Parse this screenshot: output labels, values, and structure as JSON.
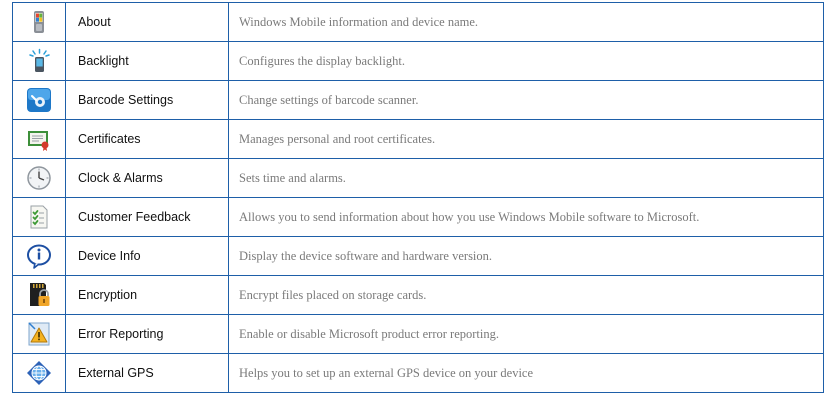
{
  "settings": [
    {
      "icon": "device-icon",
      "name": "About",
      "description": "Windows Mobile information and device name."
    },
    {
      "icon": "backlight-icon",
      "name": "Backlight",
      "description": "Configures the display backlight."
    },
    {
      "icon": "barcode-scanner-icon",
      "name": "Barcode Settings",
      "description": "Change settings of barcode scanner."
    },
    {
      "icon": "certificate-icon",
      "name": "Certificates",
      "description": "Manages personal and root certificates."
    },
    {
      "icon": "clock-icon",
      "name": "Clock & Alarms",
      "description": "Sets time and alarms."
    },
    {
      "icon": "feedback-checklist-icon",
      "name": "Customer Feedback",
      "description": "Allows you to send information about how you use Windows Mobile software to Microsoft."
    },
    {
      "icon": "info-icon",
      "name": "Device Info",
      "description": "Display the device software and hardware version."
    },
    {
      "icon": "encryption-lock-icon",
      "name": "Encryption",
      "description": "Encrypt files placed on storage cards."
    },
    {
      "icon": "error-warning-icon",
      "name": "Error Reporting",
      "description": "Enable or disable Microsoft product error reporting."
    },
    {
      "icon": "globe-gps-icon",
      "name": "External GPS",
      "description": "Helps you to set up an external GPS device on your device"
    }
  ],
  "colors": {
    "border": "#1e5fa8",
    "description_text": "#7a7a7a",
    "name_text": "#111111"
  }
}
